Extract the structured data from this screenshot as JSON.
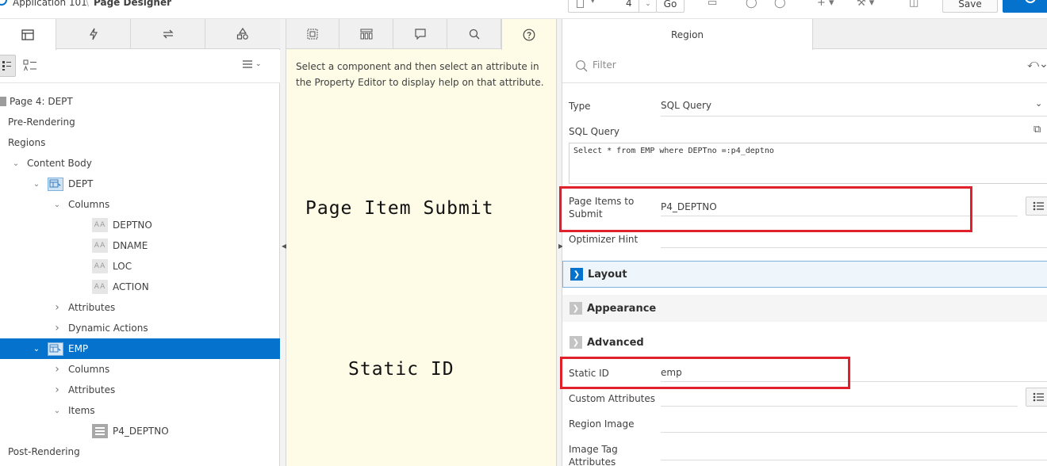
{
  "topbar": {
    "app_name": "Application 101",
    "separator": "\\",
    "page_designer": "Page Designer",
    "page_number": "4",
    "go_label": "Go",
    "save_label": "Save"
  },
  "left": {
    "tree": [
      {
        "label": "Page 4: DEPT",
        "kind": "page",
        "indent": 0,
        "chevron": "none"
      },
      {
        "label": "Pre-Rendering",
        "kind": "text",
        "indent": 0,
        "chevron": "none"
      },
      {
        "label": "Regions",
        "kind": "text",
        "indent": 0,
        "chevron": "none"
      },
      {
        "label": "Content Body",
        "kind": "text",
        "indent": 1,
        "chevron": "down"
      },
      {
        "label": "DEPT",
        "kind": "region",
        "indent": 2,
        "chevron": "down"
      },
      {
        "label": "Columns",
        "kind": "text",
        "indent": 3,
        "chevron": "down"
      },
      {
        "label": "DEPTNO",
        "kind": "column",
        "indent": 4,
        "chevron": "none"
      },
      {
        "label": "DNAME",
        "kind": "column",
        "indent": 4,
        "chevron": "none"
      },
      {
        "label": "LOC",
        "kind": "column",
        "indent": 4,
        "chevron": "none"
      },
      {
        "label": "ACTION",
        "kind": "column",
        "indent": 4,
        "chevron": "none"
      },
      {
        "label": "Attributes",
        "kind": "text",
        "indent": 3,
        "chevron": "right"
      },
      {
        "label": "Dynamic Actions",
        "kind": "text",
        "indent": 3,
        "chevron": "right"
      },
      {
        "label": "EMP",
        "kind": "region",
        "indent": 2,
        "chevron": "down",
        "selected": true
      },
      {
        "label": "Columns",
        "kind": "text",
        "indent": 3,
        "chevron": "right"
      },
      {
        "label": "Attributes",
        "kind": "text",
        "indent": 3,
        "chevron": "right"
      },
      {
        "label": "Items",
        "kind": "text",
        "indent": 3,
        "chevron": "down"
      },
      {
        "label": "P4_DEPTNO",
        "kind": "item",
        "indent": 4,
        "chevron": "none"
      },
      {
        "label": "Post-Rendering",
        "kind": "text",
        "indent": 0,
        "chevron": "none"
      }
    ],
    "column_icon_text": "AA"
  },
  "middle": {
    "help_text": "Select a component and then select an attribute in the Property Editor to display help on that attribute.",
    "annotation_1": "Page Item Submit",
    "annotation_2": "Static ID"
  },
  "right": {
    "tab_label": "Region",
    "filter_placeholder": "Filter",
    "type_label": "Type",
    "type_value": "SQL Query",
    "sql_label": "SQL Query",
    "sql_value": "Select * from EMP where DEPTno =:p4_deptno",
    "items_submit_label": "Page Items to Submit",
    "items_submit_value": "P4_DEPTNO",
    "optimizer_label": "Optimizer Hint",
    "groups": {
      "layout": "Layout",
      "appearance": "Appearance",
      "advanced": "Advanced"
    },
    "static_id_label": "Static ID",
    "static_id_value": "emp",
    "custom_attr_label": "Custom Attributes",
    "region_image_label": "Region Image",
    "image_tag_label": "Image Tag Attributes"
  },
  "colors": {
    "selection": "#0572ce",
    "help_bg": "#fefbe6",
    "highlight_box": "#e0202a"
  }
}
